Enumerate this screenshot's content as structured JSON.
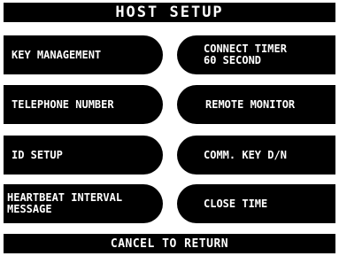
{
  "header": {
    "title": "HOST SETUP"
  },
  "left_buttons": [
    {
      "label": "KEY MANAGEMENT"
    },
    {
      "label": "TELEPHONE NUMBER"
    },
    {
      "label": "ID SETUP"
    },
    {
      "label": "HEARTBEAT INTERVAL\nMESSAGE"
    }
  ],
  "right_buttons": [
    {
      "label": "CONNECT TIMER\n60 SECOND"
    },
    {
      "label": "REMOTE MONITOR"
    },
    {
      "label": "COMM. KEY D/N"
    },
    {
      "label": "CLOSE TIME"
    }
  ],
  "footer": {
    "cancel_label": "CANCEL TO RETURN"
  },
  "colors": {
    "background": "#ffffff",
    "button": "#000000",
    "text": "#ffffff"
  }
}
